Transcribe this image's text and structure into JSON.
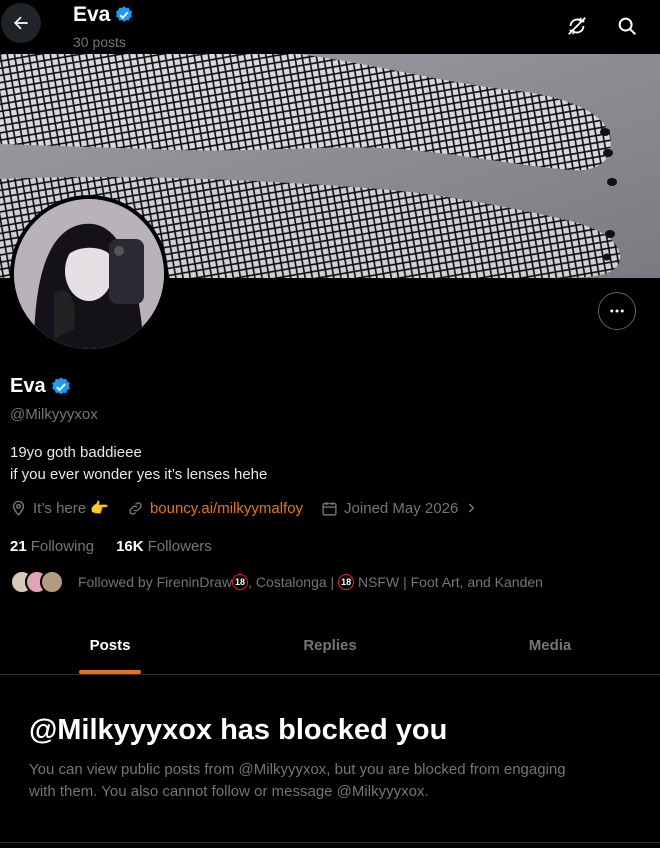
{
  "header": {
    "back_icon": "arrow-left-icon",
    "name": "Eva",
    "posts_count": "30 posts",
    "icons": [
      "refresh-off-icon",
      "search-icon"
    ]
  },
  "profile": {
    "name": "Eva",
    "verified": true,
    "handle": "@Milkyyyxox",
    "bio_line1": "19yo goth baddieee",
    "bio_line2": "if you ever wonder yes it’s lenses hehe",
    "location": "It’s here 👉",
    "link": "bouncy.ai/milkyymalfoy",
    "joined": "Joined May 2026",
    "following_count": "21",
    "following_label": "Following",
    "followers_count": "16K",
    "followers_label": "Followers",
    "followed_by_prefix": "Followed by FireninDraw",
    "followed_by_middle": ", Costalonga | ",
    "followed_by_suffix": " NSFW | Foot Art, and Kanden",
    "badge_18": "18"
  },
  "tabs": [
    {
      "label": "Posts",
      "active": true
    },
    {
      "label": "Replies",
      "active": false
    },
    {
      "label": "Media",
      "active": false
    }
  ],
  "blocked": {
    "title": "@Milkyyyxox has blocked you",
    "text": "You can view public posts from @Milkyyyxox, but you are blocked from engaging with them. You also cannot follow or message @Milkyyyxox."
  },
  "colors": {
    "background": "#000000",
    "accent": "#e8721c",
    "verified": "#1d9bf0",
    "muted": "#71767b"
  }
}
